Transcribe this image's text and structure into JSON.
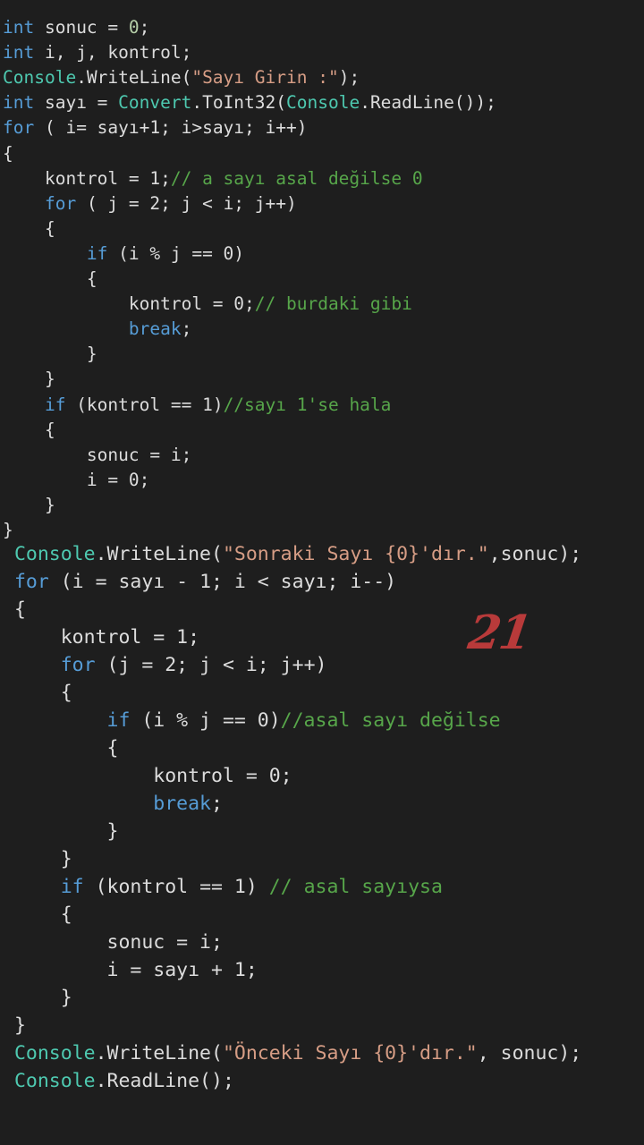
{
  "theme": {
    "background": "#1e1e1e",
    "text": "#dcdcdc",
    "keyword": "#569cd6",
    "type": "#4ec9b0",
    "string": "#d69d85",
    "comment": "#57a64a",
    "number": "#b5cea8",
    "watermark": "#b83a3a"
  },
  "code_lines": [
    [
      {
        "t": "int",
        "c": "kw"
      },
      {
        "t": " sonuc = "
      },
      {
        "t": "0",
        "c": "num"
      },
      {
        "t": ";"
      }
    ],
    [
      {
        "t": "int",
        "c": "kw"
      },
      {
        "t": " i, j, kontrol;"
      }
    ],
    [
      {
        "t": "Console",
        "c": "cls"
      },
      {
        "t": ".WriteLine("
      },
      {
        "t": "\"Sayı Girin :\"",
        "c": "str"
      },
      {
        "t": ");"
      }
    ],
    [
      {
        "t": "int",
        "c": "kw"
      },
      {
        "t": " sayı = "
      },
      {
        "t": "Convert",
        "c": "cls"
      },
      {
        "t": ".ToInt32("
      },
      {
        "t": "Console",
        "c": "cls"
      },
      {
        "t": ".ReadLine());"
      }
    ],
    [
      {
        "t": "for",
        "c": "kw"
      },
      {
        "t": " ( i= sayı+1; i>sayı; i++)"
      }
    ],
    [
      {
        "t": "{"
      }
    ],
    [
      {
        "t": "    kontrol = 1;"
      },
      {
        "t": "// a sayı asal değilse 0",
        "c": "cm"
      }
    ],
    [
      {
        "t": "    "
      },
      {
        "t": "for",
        "c": "kw"
      },
      {
        "t": " ( j = 2; j < i; j++)"
      }
    ],
    [
      {
        "t": "    {"
      }
    ],
    [
      {
        "t": "        "
      },
      {
        "t": "if",
        "c": "kw"
      },
      {
        "t": " (i % j == 0)"
      }
    ],
    [
      {
        "t": "        {"
      }
    ],
    [
      {
        "t": "            kontrol = 0;"
      },
      {
        "t": "// burdaki gibi",
        "c": "cm"
      }
    ],
    [
      {
        "t": "            "
      },
      {
        "t": "break",
        "c": "kw"
      },
      {
        "t": ";"
      }
    ],
    [
      {
        "t": "        }"
      }
    ],
    [
      {
        "t": "    }"
      }
    ],
    [
      {
        "t": "    "
      },
      {
        "t": "if",
        "c": "kw"
      },
      {
        "t": " (kontrol == 1)"
      },
      {
        "t": "//sayı 1'se hala",
        "c": "cm"
      }
    ],
    [
      {
        "t": "    {"
      }
    ],
    [
      {
        "t": "        sonuc = i;"
      }
    ],
    [
      {
        "t": "        i = 0;"
      }
    ],
    [
      {
        "t": "    }"
      }
    ],
    [
      {
        "t": "}"
      }
    ],
    [
      {
        "t": " "
      },
      {
        "t": "Console",
        "c": "cls"
      },
      {
        "t": ".WriteLine("
      },
      {
        "t": "\"Sonraki Sayı {0}'dır.\"",
        "c": "str"
      },
      {
        "t": ",sonuc);"
      }
    ],
    [
      {
        "t": " "
      },
      {
        "t": "for",
        "c": "kw"
      },
      {
        "t": " (i = sayı - 1; i < sayı; i--)"
      }
    ],
    [
      {
        "t": " {"
      }
    ],
    [
      {
        "t": "     kontrol = 1;"
      }
    ],
    [
      {
        "t": "     "
      },
      {
        "t": "for",
        "c": "kw"
      },
      {
        "t": " (j = 2; j < i; j++)"
      }
    ],
    [
      {
        "t": "     {"
      }
    ],
    [
      {
        "t": "         "
      },
      {
        "t": "if",
        "c": "kw"
      },
      {
        "t": " (i % j == 0)"
      },
      {
        "t": "//asal sayı değilse",
        "c": "cm"
      }
    ],
    [
      {
        "t": "         {"
      }
    ],
    [
      {
        "t": "             kontrol = 0;"
      }
    ],
    [
      {
        "t": "             "
      },
      {
        "t": "break",
        "c": "kw"
      },
      {
        "t": ";"
      }
    ],
    [
      {
        "t": "         }"
      }
    ],
    [
      {
        "t": "     }"
      }
    ],
    [
      {
        "t": "     "
      },
      {
        "t": "if",
        "c": "kw"
      },
      {
        "t": " (kontrol == 1) "
      },
      {
        "t": "// asal sayıysa",
        "c": "cm"
      }
    ],
    [
      {
        "t": "     {"
      }
    ],
    [
      {
        "t": "         sonuc = i;"
      }
    ],
    [
      {
        "t": "         i = sayı + 1;"
      }
    ],
    [
      {
        "t": "     }"
      }
    ],
    [
      {
        "t": " }"
      }
    ],
    [
      {
        "t": " "
      },
      {
        "t": "Console",
        "c": "cls"
      },
      {
        "t": ".WriteLine("
      },
      {
        "t": "\"Önceki Sayı {0}'dır.\"",
        "c": "str"
      },
      {
        "t": ", sonuc);"
      }
    ],
    [
      {
        "t": " "
      },
      {
        "t": "Console",
        "c": "cls"
      },
      {
        "t": ".ReadLine();"
      }
    ]
  ],
  "watermark": {
    "text": "21"
  }
}
